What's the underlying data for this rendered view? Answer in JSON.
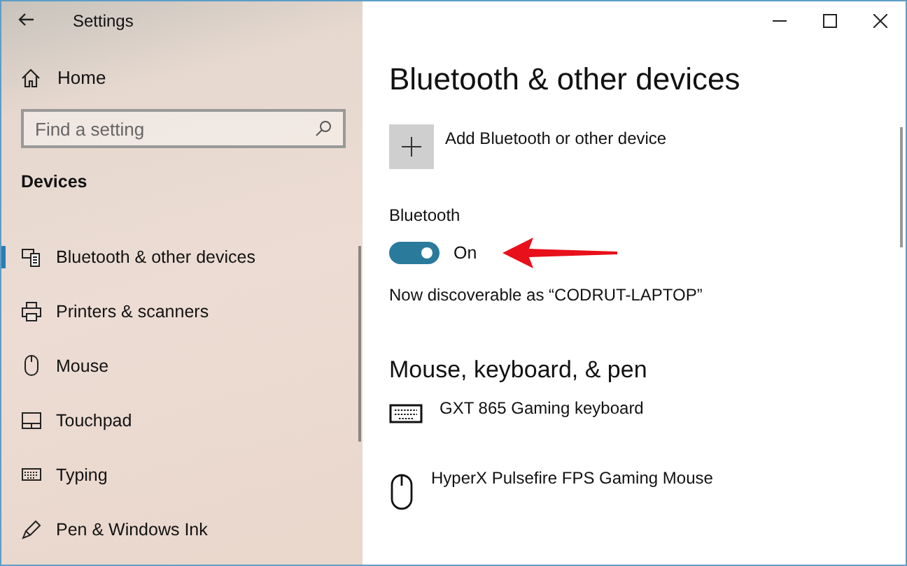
{
  "window": {
    "title": "Settings"
  },
  "sidebar": {
    "home": "Home",
    "search": {
      "placeholder": "Find a setting"
    },
    "section": "Devices",
    "items": [
      {
        "label": "Bluetooth & other devices",
        "kind": "bluetooth",
        "selected": true
      },
      {
        "label": "Printers & scanners",
        "kind": "printer",
        "selected": false
      },
      {
        "label": "Mouse",
        "kind": "mouse",
        "selected": false
      },
      {
        "label": "Touchpad",
        "kind": "touchpad",
        "selected": false
      },
      {
        "label": "Typing",
        "kind": "typing",
        "selected": false
      },
      {
        "label": "Pen & Windows Ink",
        "kind": "pen",
        "selected": false
      }
    ]
  },
  "page": {
    "title": "Bluetooth & other devices",
    "add_device": "Add Bluetooth or other device",
    "bluetooth": {
      "label": "Bluetooth",
      "on": true,
      "state_text": "On"
    },
    "discoverable": "Now discoverable as “CODRUT-LAPTOP”"
  },
  "section": {
    "title": "Mouse, keyboard, & pen",
    "devices": [
      {
        "name": "GXT 865 Gaming keyboard",
        "kind": "keyboard"
      },
      {
        "name": "HyperX Pulsefire FPS Gaming Mouse",
        "kind": "mouse"
      }
    ]
  }
}
